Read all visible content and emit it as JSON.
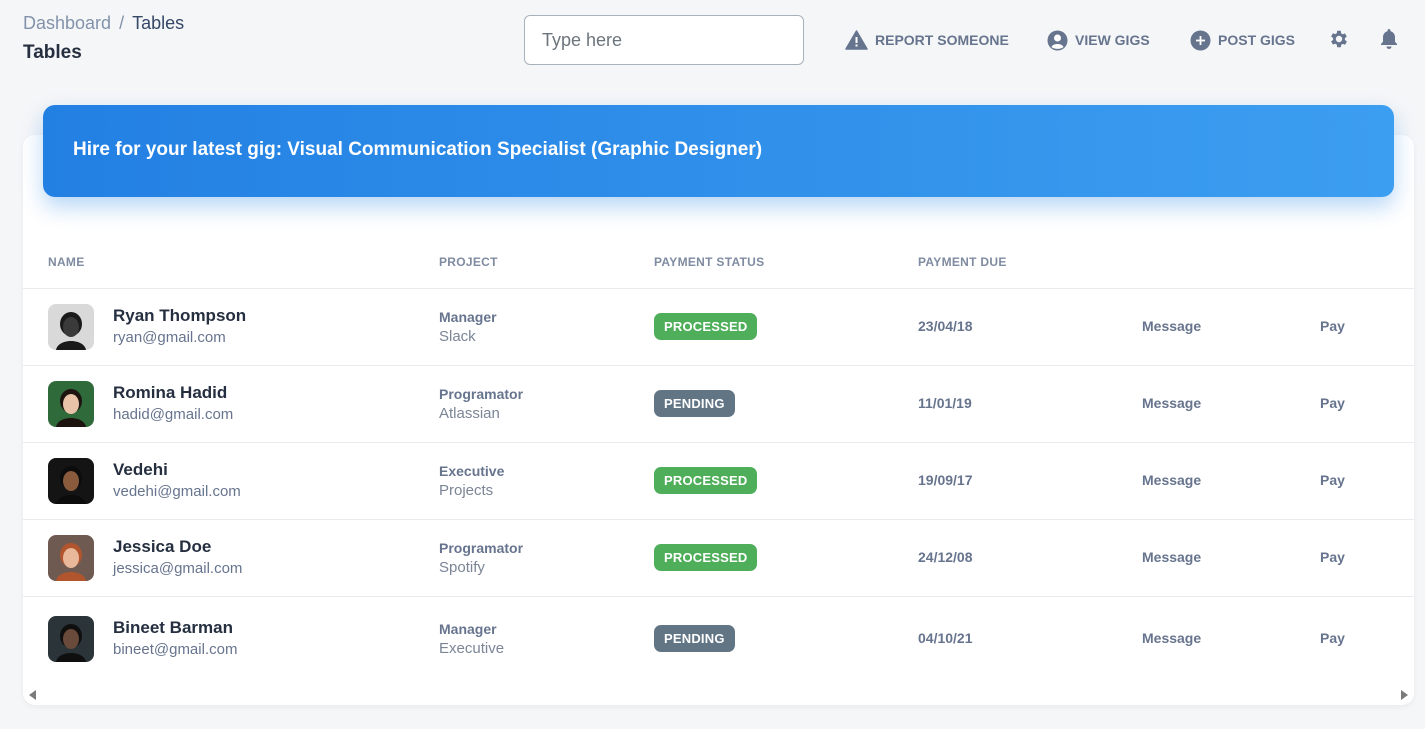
{
  "breadcrumb": {
    "parent": "Dashboard",
    "separator": "/",
    "current": "Tables"
  },
  "page_title": "Tables",
  "search": {
    "placeholder": "Type here",
    "value": ""
  },
  "nav": {
    "report_label": "REPORT SOMEONE",
    "view_gigs_label": "VIEW GIGS",
    "post_gigs_label": "POST GIGS"
  },
  "banner": {
    "text": "Hire for your latest gig: Visual Communication Specialist (Graphic Designer)"
  },
  "table": {
    "headers": [
      "NAME",
      "PROJECT",
      "PAYMENT STATUS",
      "PAYMENT DUE"
    ],
    "rows": [
      {
        "name": "Ryan Thompson",
        "email": "ryan@gmail.com",
        "role": "Manager",
        "org": "Slack",
        "status": "PROCESSED",
        "due": "23/04/18",
        "message": "Message",
        "pay": "Pay"
      },
      {
        "name": "Romina Hadid",
        "email": "hadid@gmail.com",
        "role": "Programator",
        "org": "Atlassian",
        "status": "PENDING",
        "due": "11/01/19",
        "message": "Message",
        "pay": "Pay"
      },
      {
        "name": "Vedehi",
        "email": "vedehi@gmail.com",
        "role": "Executive",
        "org": "Projects",
        "status": "PROCESSED",
        "due": "19/09/17",
        "message": "Message",
        "pay": "Pay"
      },
      {
        "name": "Jessica Doe",
        "email": "jessica@gmail.com",
        "role": "Programator",
        "org": "Spotify",
        "status": "PROCESSED",
        "due": "24/12/08",
        "message": "Message",
        "pay": "Pay"
      },
      {
        "name": "Bineet Barman",
        "email": "bineet@gmail.com",
        "role": "Manager",
        "org": "Executive",
        "status": "PENDING",
        "due": "04/10/21",
        "message": "Message",
        "pay": "Pay"
      }
    ]
  },
  "colors": {
    "processed": "#4fae5a",
    "pending": "#627585",
    "banner_start": "#2380e3",
    "banner_end": "#3c9ef0"
  }
}
